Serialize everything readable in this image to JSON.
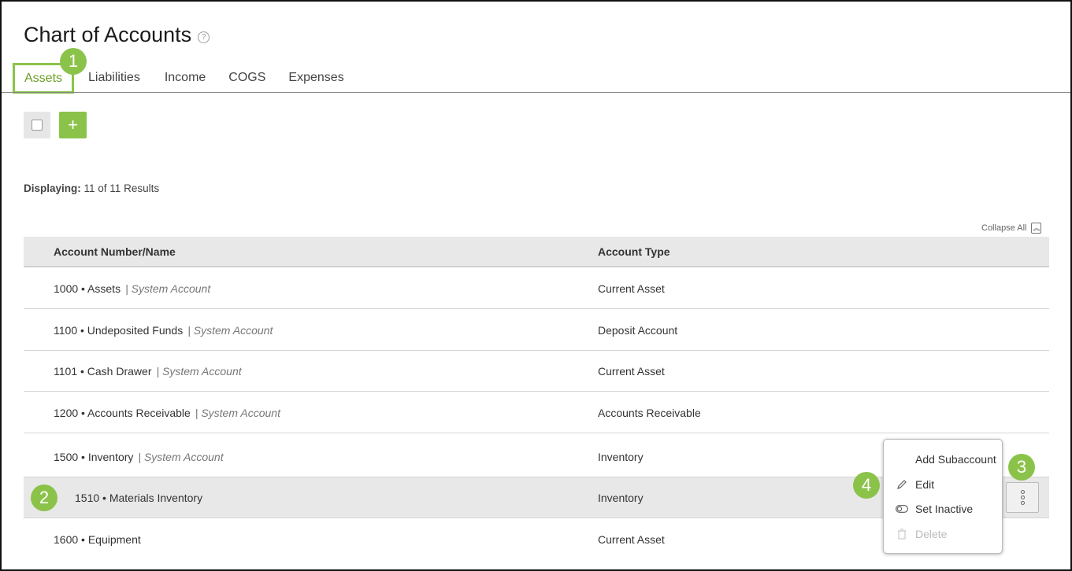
{
  "page": {
    "title": "Chart of Accounts",
    "help_icon": "question-circle-icon"
  },
  "tabs": [
    {
      "label": "Assets",
      "active": true
    },
    {
      "label": "Liabilities",
      "active": false
    },
    {
      "label": "Income",
      "active": false
    },
    {
      "label": "COGS",
      "active": false
    },
    {
      "label": "Expenses",
      "active": false
    }
  ],
  "toolbar": {
    "add_label": "+"
  },
  "results": {
    "label": "Displaying:",
    "value": "11 of 11 Results"
  },
  "collapse_all": "Collapse All",
  "table": {
    "columns": [
      "Account Number/Name",
      "Account Type"
    ],
    "rows": [
      {
        "name": "1000 • Assets",
        "tag": "| System Account",
        "type": "Current Asset"
      },
      {
        "name": "1100 • Undeposited Funds",
        "tag": "| System Account",
        "type": "Deposit Account"
      },
      {
        "name": "1101 • Cash Drawer",
        "tag": "| System Account",
        "type": "Current Asset"
      },
      {
        "name": "1200 • Accounts Receivable",
        "tag": "| System Account",
        "type": "Accounts Receivable"
      },
      {
        "name": "1500 • Inventory",
        "tag": "| System Account",
        "type": "Inventory"
      },
      {
        "name": "1510 • Materials Inventory",
        "tag": "",
        "type": "Inventory",
        "selected": true
      },
      {
        "name": "1600 • Equipment",
        "tag": "",
        "type": "Current Asset"
      }
    ]
  },
  "context_menu": {
    "items": [
      {
        "label": "Add Subaccount",
        "icon": "",
        "disabled": false
      },
      {
        "label": "Edit",
        "icon": "pencil-icon",
        "disabled": false
      },
      {
        "label": "Set Inactive",
        "icon": "toggle-icon",
        "disabled": false
      },
      {
        "label": "Delete",
        "icon": "trash-icon",
        "disabled": true
      }
    ]
  },
  "callouts": [
    "1",
    "2",
    "3",
    "4"
  ],
  "colors": {
    "accent": "#8bc34a",
    "tab_active_text": "#6a9e24",
    "header_bg": "#e8e8e8"
  }
}
